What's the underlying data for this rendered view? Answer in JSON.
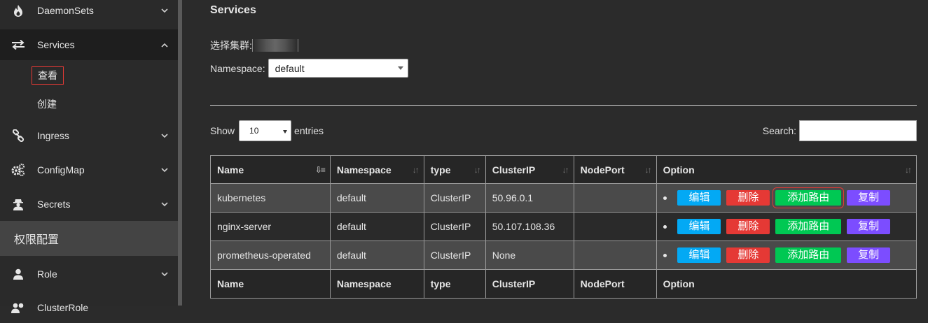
{
  "sidebar": {
    "items": [
      {
        "label": "DaemonSets",
        "icon": "fire-icon"
      },
      {
        "label": "Services",
        "icon": "exchange-icon"
      },
      {
        "label": "Ingress",
        "icon": "link-icon"
      },
      {
        "label": "ConfigMap",
        "icon": "cogs-icon"
      },
      {
        "label": "Secrets",
        "icon": "user-secret-icon"
      },
      {
        "label": "Role",
        "icon": "user-icon"
      },
      {
        "label": "ClusterRole",
        "icon": "users-icon"
      }
    ],
    "services_sub": {
      "view": "查看",
      "create": "创建"
    },
    "section_header": "权限配置"
  },
  "main": {
    "title": "Services",
    "cluster_label": "选择集群:",
    "namespace_label": "Namespace:",
    "namespace_value": "default",
    "show_label": "Show",
    "page_length": "10",
    "entries_label": "entries",
    "search_label": "Search:"
  },
  "table": {
    "headers": [
      "Name",
      "Namespace",
      "type",
      "ClusterIP",
      "NodePort",
      "Option"
    ],
    "rows": [
      {
        "name": "kubernetes",
        "namespace": "default",
        "type": "ClusterIP",
        "cluster_ip": "50.96.0.1",
        "node_port": ""
      },
      {
        "name": "nginx-server",
        "namespace": "default",
        "type": "ClusterIP",
        "cluster_ip": "50.107.108.36",
        "node_port": ""
      },
      {
        "name": "prometheus-operated",
        "namespace": "default",
        "type": "ClusterIP",
        "cluster_ip": "None",
        "node_port": ""
      }
    ],
    "buttons": {
      "edit": "编辑",
      "delete": "删除",
      "add_route": "添加路由",
      "copy": "复制"
    }
  },
  "colors": {
    "edit": "#03a9f4",
    "delete": "#e53935",
    "add_route": "#00c853",
    "copy": "#7c4dff",
    "highlight": "#e53935"
  }
}
